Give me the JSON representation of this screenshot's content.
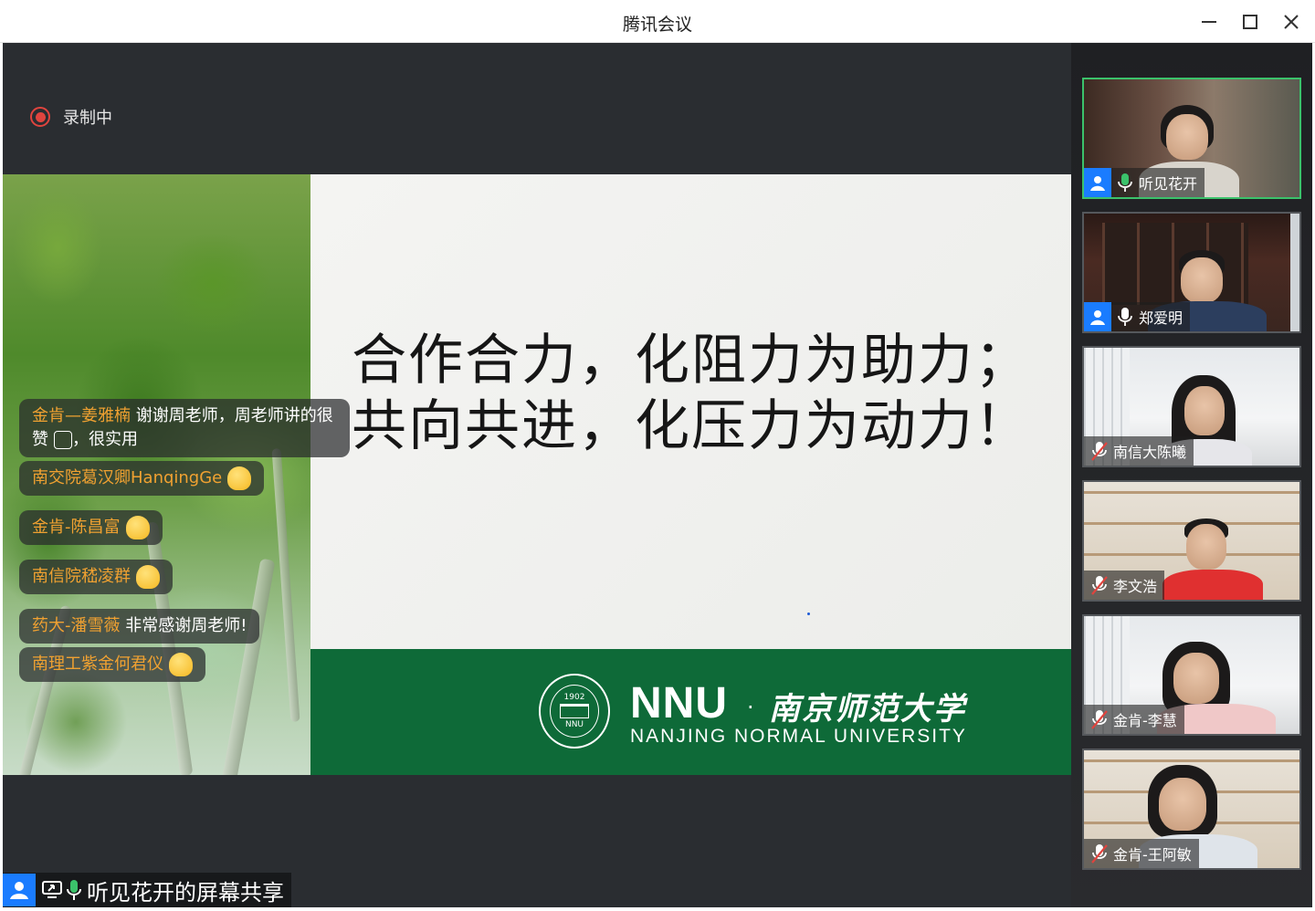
{
  "window": {
    "title": "腾讯会议"
  },
  "recording": {
    "label": "录制中"
  },
  "slide": {
    "line1": "合作合力，化阻力为助力；",
    "line2": "共向共进，化压力为动力！",
    "brand_en": "NNU",
    "brand_dot": "·",
    "brand_cn": "南京师范大学",
    "brand_sub": "NANJING NORMAL UNIVERSITY",
    "seal_year": "1902",
    "seal_abbr": "NNU"
  },
  "chat": [
    {
      "name": "金肯—姜雅楠",
      "text": " 谢谢周老师，周老师讲的很赞",
      "text2": "，很实用"
    },
    {
      "name": "南交院葛汉卿HanqingGe",
      "text": ""
    },
    {
      "name": "金肯-陈昌富",
      "text": ""
    },
    {
      "name": "南信院嵇凌群",
      "text": ""
    },
    {
      "name": "药大-潘雪薇",
      "text": " 非常感谢周老师!"
    },
    {
      "name": "南理工紫金何君仪",
      "text": ""
    }
  ],
  "share": {
    "label": "听见花开的屏幕共享"
  },
  "participants": [
    {
      "name": "听见花开",
      "mic": "on",
      "active": true
    },
    {
      "name": "郑爱明",
      "mic": "on",
      "active": false
    },
    {
      "name": "南信大陈曦",
      "mic": "muted",
      "active": false
    },
    {
      "name": "李文浩",
      "mic": "muted",
      "active": false
    },
    {
      "name": "金肯-李慧",
      "mic": "muted",
      "active": false
    },
    {
      "name": "金肯-王阿敏",
      "mic": "muted",
      "active": false
    }
  ],
  "colors": {
    "accent_blue": "#1a7cff",
    "active_border": "#3bc26b",
    "chat_name": "#f0a131",
    "record_red": "#e0443e",
    "brand_green": "#0e6a38"
  }
}
